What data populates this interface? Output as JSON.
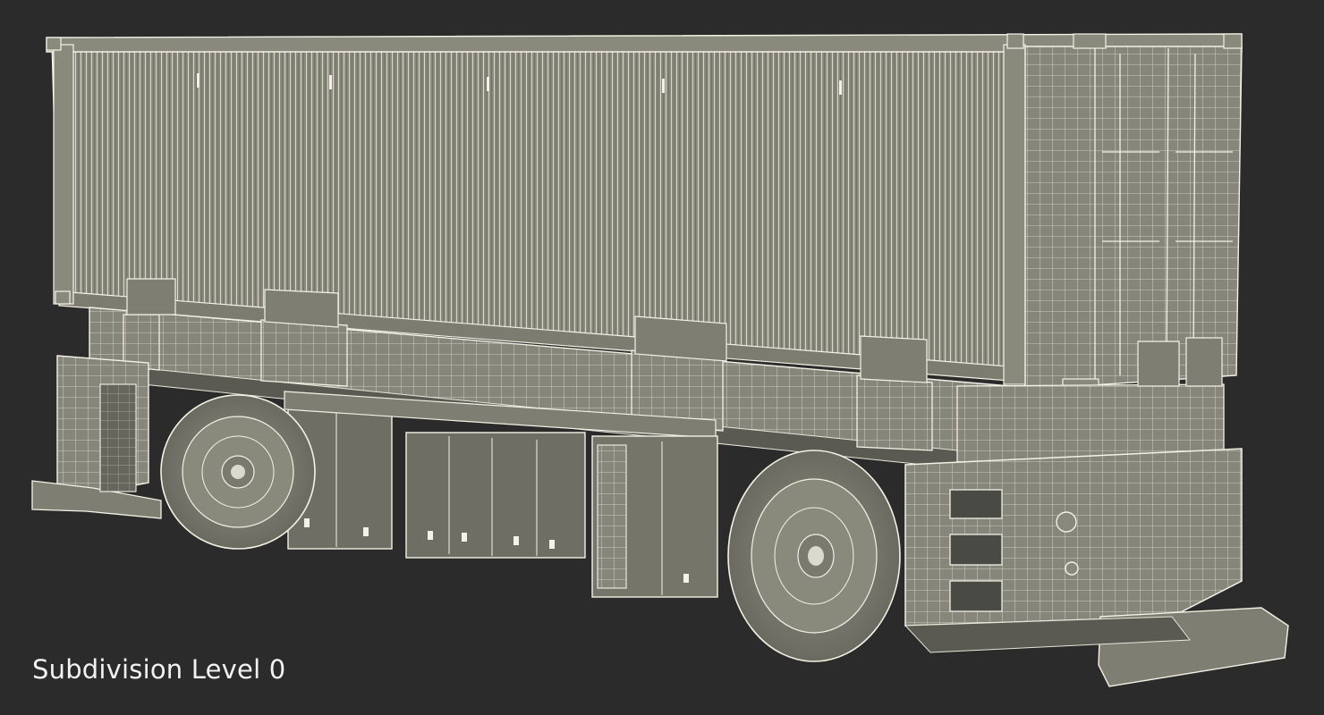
{
  "render": {
    "subject": "automated guided vehicle carrying a shipping container, wireframe render",
    "caption": "Subdivision Level 0"
  },
  "colors": {
    "background": "#2b2b2b",
    "mesh_fill": "#8a8a7c",
    "mesh_shadow": "#5f5f55",
    "wire": "#f4f2e6",
    "caption_text": "#f2f2f2"
  }
}
